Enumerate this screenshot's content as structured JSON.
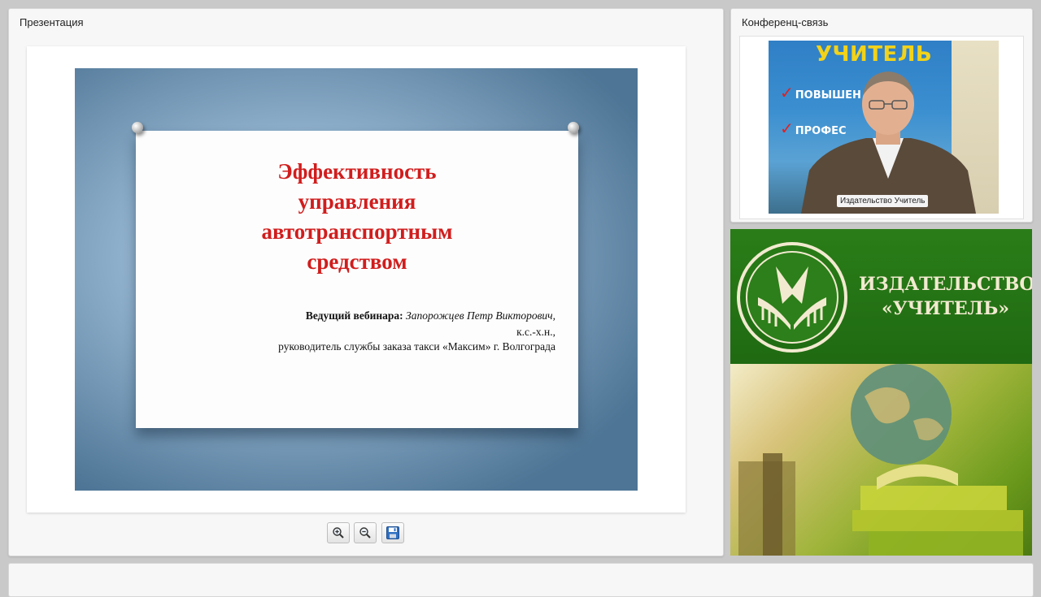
{
  "presentation": {
    "panel_title": "Презентация",
    "slide": {
      "title": "Эффективность\nуправления\nавтотранспортным\nсредством",
      "presenter_label": "Ведущий вебинара:",
      "presenter_name": "Запорожцев Петр Викторович,",
      "presenter_degree": "к.с.-х.н.,",
      "presenter_position": "руководитель службы заказа такси «Максим» г. Волгограда"
    },
    "toolbar": {
      "zoom_in": "zoom-in-icon",
      "zoom_out": "zoom-out-icon",
      "save": "save-icon"
    }
  },
  "conference": {
    "panel_title": "Конференц-связь",
    "video_caption": "Издательство Учитель",
    "background_logo_text": "УЧИТЕЛЬ",
    "background_banner_lines": [
      "ПОВЫШЕН",
      "ПРОФЕС"
    ]
  },
  "publisher_banner": {
    "name_line1": "ИЗДАТЕЛЬСТВО",
    "name_line2": "«УЧИТЕЛЬ»",
    "colors": {
      "green": "#1f6a12",
      "cream": "#f2ead0"
    }
  }
}
